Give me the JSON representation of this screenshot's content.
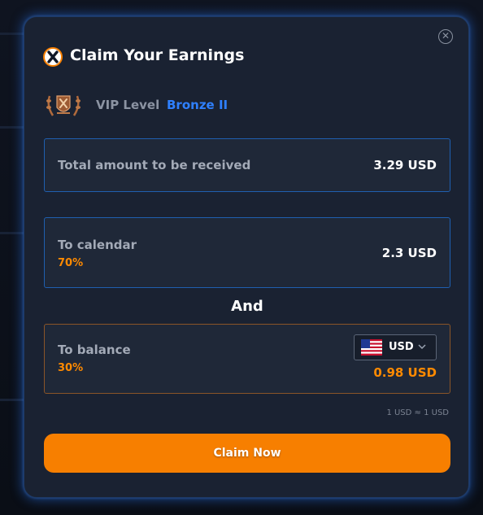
{
  "modal": {
    "title": "Claim Your Earnings",
    "close_icon": "close-icon",
    "logo_icon": "x-brand-logo"
  },
  "vip": {
    "label": "VIP Level",
    "value": "Bronze II",
    "emblem_icon": "bronze-laurel-emblem"
  },
  "total": {
    "label": "Total amount to be received",
    "amount": "3.29 USD"
  },
  "calendar": {
    "label": "To calendar",
    "percent": "70%",
    "amount": "2.3 USD"
  },
  "separator": "And",
  "balance": {
    "label": "To balance",
    "percent": "30%",
    "currency": "USD",
    "currency_flag": "us-flag-icon",
    "amount": "0.98 USD"
  },
  "rate": "1 USD ≈ 1 USD",
  "claim_button": "Claim Now",
  "colors": {
    "accent_orange": "#f77f00",
    "accent_blue": "#2f80ff",
    "modal_bg": "#1a2232",
    "card_bg": "#1f2838"
  }
}
